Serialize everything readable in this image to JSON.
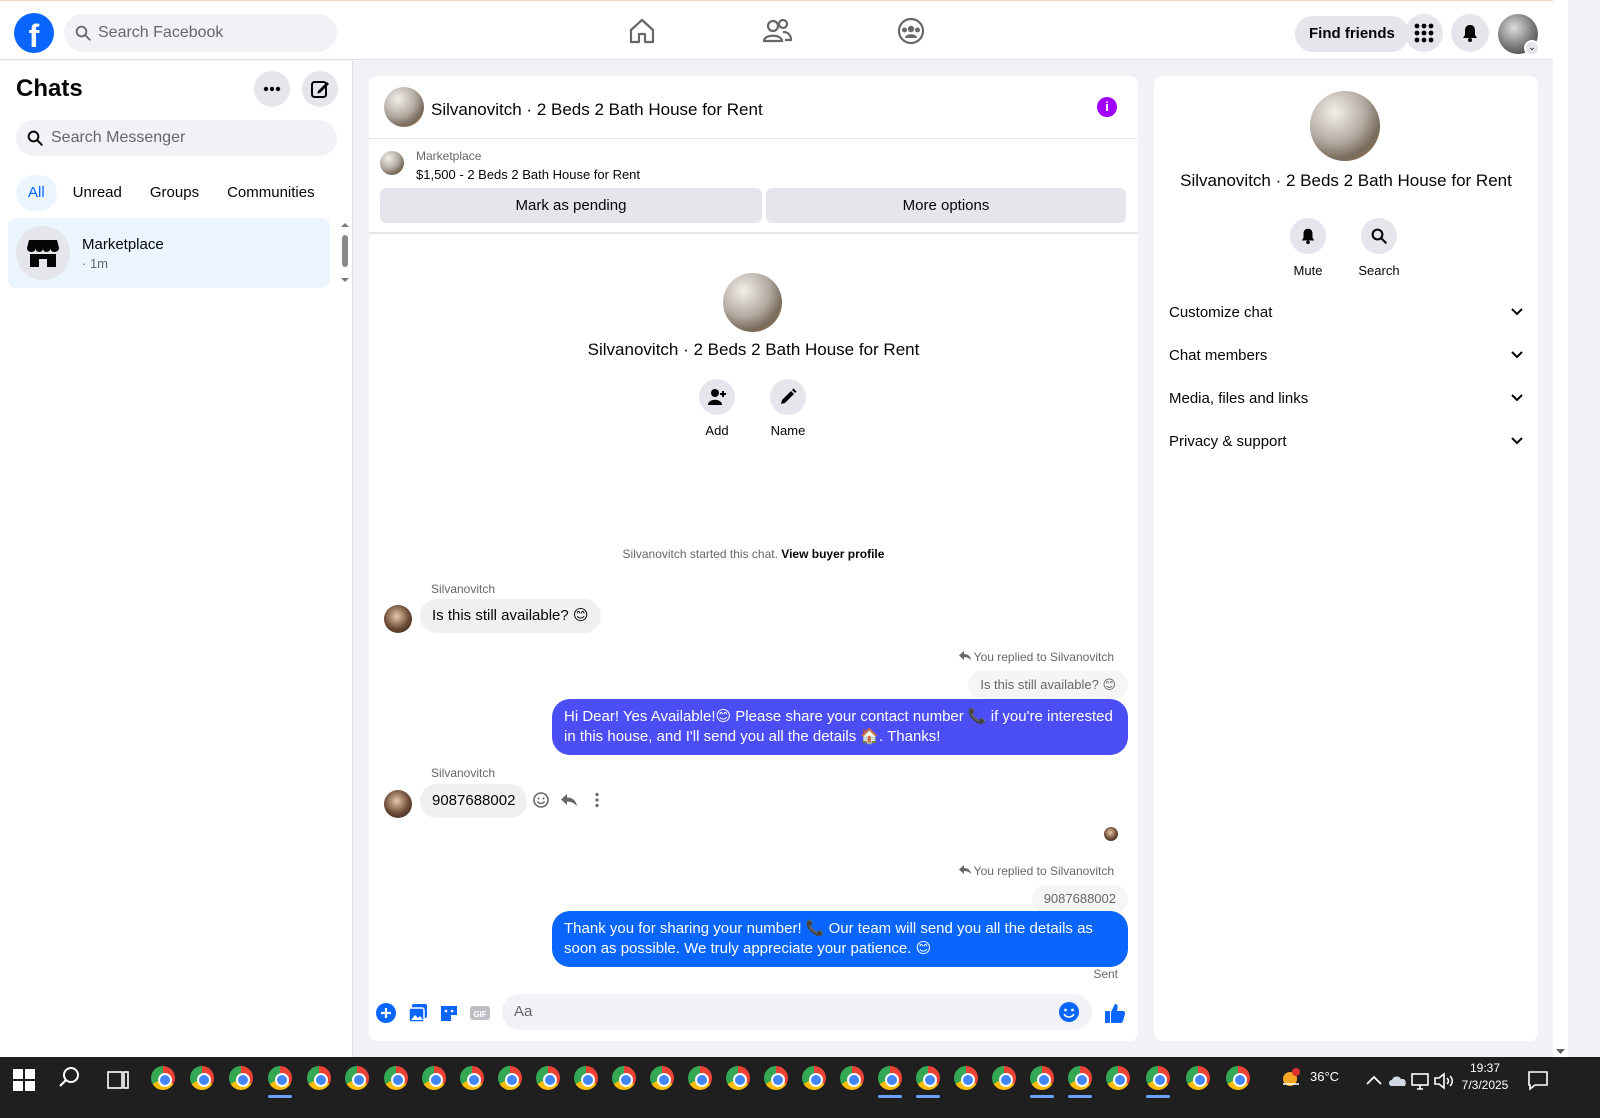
{
  "topnav": {
    "logo": "f",
    "search_placeholder": "Search Facebook",
    "find_friends": "Find friends",
    "icons": [
      "home-icon",
      "friends-icon",
      "groups-icon",
      "menu-grid-icon",
      "notifications-icon"
    ]
  },
  "sidebar": {
    "title": "Chats",
    "search_placeholder": "Search Messenger",
    "filters": [
      "All",
      "Unread",
      "Groups",
      "Communities"
    ],
    "chats": [
      {
        "name": "Marketplace",
        "time": "· 1m"
      }
    ]
  },
  "chat": {
    "title": "Silvanovitch · 2 Beds 2 Bath House for Rent",
    "marketplace_label": "Marketplace",
    "listing": "$1,500 - 2 Beds 2 Bath House for Rent",
    "mark_pending": "Mark as pending",
    "more_options": "More options",
    "intro_name": "Silvanovitch · 2 Beds 2 Bath House for Rent",
    "add_label": "Add",
    "name_label": "Name",
    "system_text": "Silvanovitch started this chat.",
    "view_buyer_profile": "View buyer profile",
    "messages": [
      {
        "sender": "Silvanovitch",
        "text": "Is this still available? 😊"
      },
      {
        "replied": "You replied to Silvanovitch",
        "quote": "Is this still available? 😊",
        "text": "Hi Dear! Yes Available!😊 Please share your contact number 📞 if you're interested in this house, and I'll send you all the details 🏠. Thanks!"
      },
      {
        "sender": "Silvanovitch",
        "text": "9087688002"
      },
      {
        "replied": "You replied to Silvanovitch",
        "quote": "9087688002",
        "text": "Thank you for sharing your number! 📞 Our team will send you all the details as soon as possible. We truly appreciate your patience. 😊"
      }
    ],
    "sent_label": "Sent",
    "composer_placeholder": "Aa",
    "colors": {
      "bubble_out_top": "#4b4df5",
      "bubble_out_bottom": "#0866ff",
      "accent": "#0866ff"
    }
  },
  "rightpanel": {
    "name": "Silvanovitch · 2 Beds 2 Bath House for Rent",
    "mute": "Mute",
    "search": "Search",
    "sections": [
      "Customize chat",
      "Chat members",
      "Media, files and links",
      "Privacy & support"
    ]
  },
  "taskbar": {
    "temperature": "36°C",
    "time": "19:37",
    "date": "7/3/2025"
  }
}
